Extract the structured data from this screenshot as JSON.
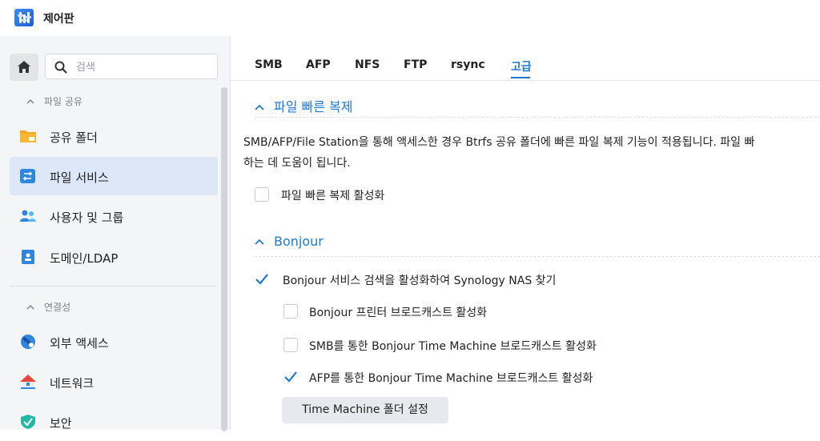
{
  "app": {
    "title": "제어판"
  },
  "sidebar": {
    "search_placeholder": "검색",
    "sections": [
      {
        "heading": "파일 공유",
        "items": [
          {
            "label": "공유 폴더",
            "icon": "folder-icon",
            "active": false
          },
          {
            "label": "파일 서비스",
            "icon": "file-services-icon",
            "active": true
          },
          {
            "label": "사용자 및 그룹",
            "icon": "users-icon",
            "active": false
          },
          {
            "label": "도메인/LDAP",
            "icon": "domain-icon",
            "active": false
          }
        ]
      },
      {
        "heading": "연결성",
        "items": [
          {
            "label": "외부 액세스",
            "icon": "external-access-icon",
            "active": false
          },
          {
            "label": "네트워크",
            "icon": "network-icon",
            "active": false
          },
          {
            "label": "보안",
            "icon": "shield-icon",
            "active": false
          }
        ]
      }
    ]
  },
  "tabs": [
    "SMB",
    "AFP",
    "NFS",
    "FTP",
    "rsync",
    "고급"
  ],
  "active_tab": "고급",
  "fast_clone": {
    "title": "파일 빠른 복제",
    "desc_line1": "SMB/AFP/File Station을 통해 액세스한 경우 Btrfs 공유 폴더에 빠른 파일 복제 기능이 적용됩니다. 파일 빠",
    "desc_line2": "하는 데 도움이 됩니다.",
    "checkbox_label": "파일 빠른 복제 활성화",
    "checked": false
  },
  "bonjour": {
    "title": "Bonjour",
    "main_checkbox": {
      "label": "Bonjour 서비스 검색을 활성화하여 Synology NAS 찾기",
      "checked": true
    },
    "sub_checkboxes": [
      {
        "label": "Bonjour 프린터 브로드캐스트 활성화",
        "checked": false
      },
      {
        "label": "SMB를 통한 Bonjour Time Machine 브로드캐스트 활성화",
        "checked": false
      },
      {
        "label": "AFP를 통한 Bonjour Time Machine 브로드캐스트 활성화",
        "checked": true
      }
    ],
    "button_label": "Time Machine 폴더 설정"
  },
  "colors": {
    "accent": "#1f78d6",
    "active_nav_bg": "#dce7f7",
    "sidebar_bg": "#f4f5f7"
  }
}
